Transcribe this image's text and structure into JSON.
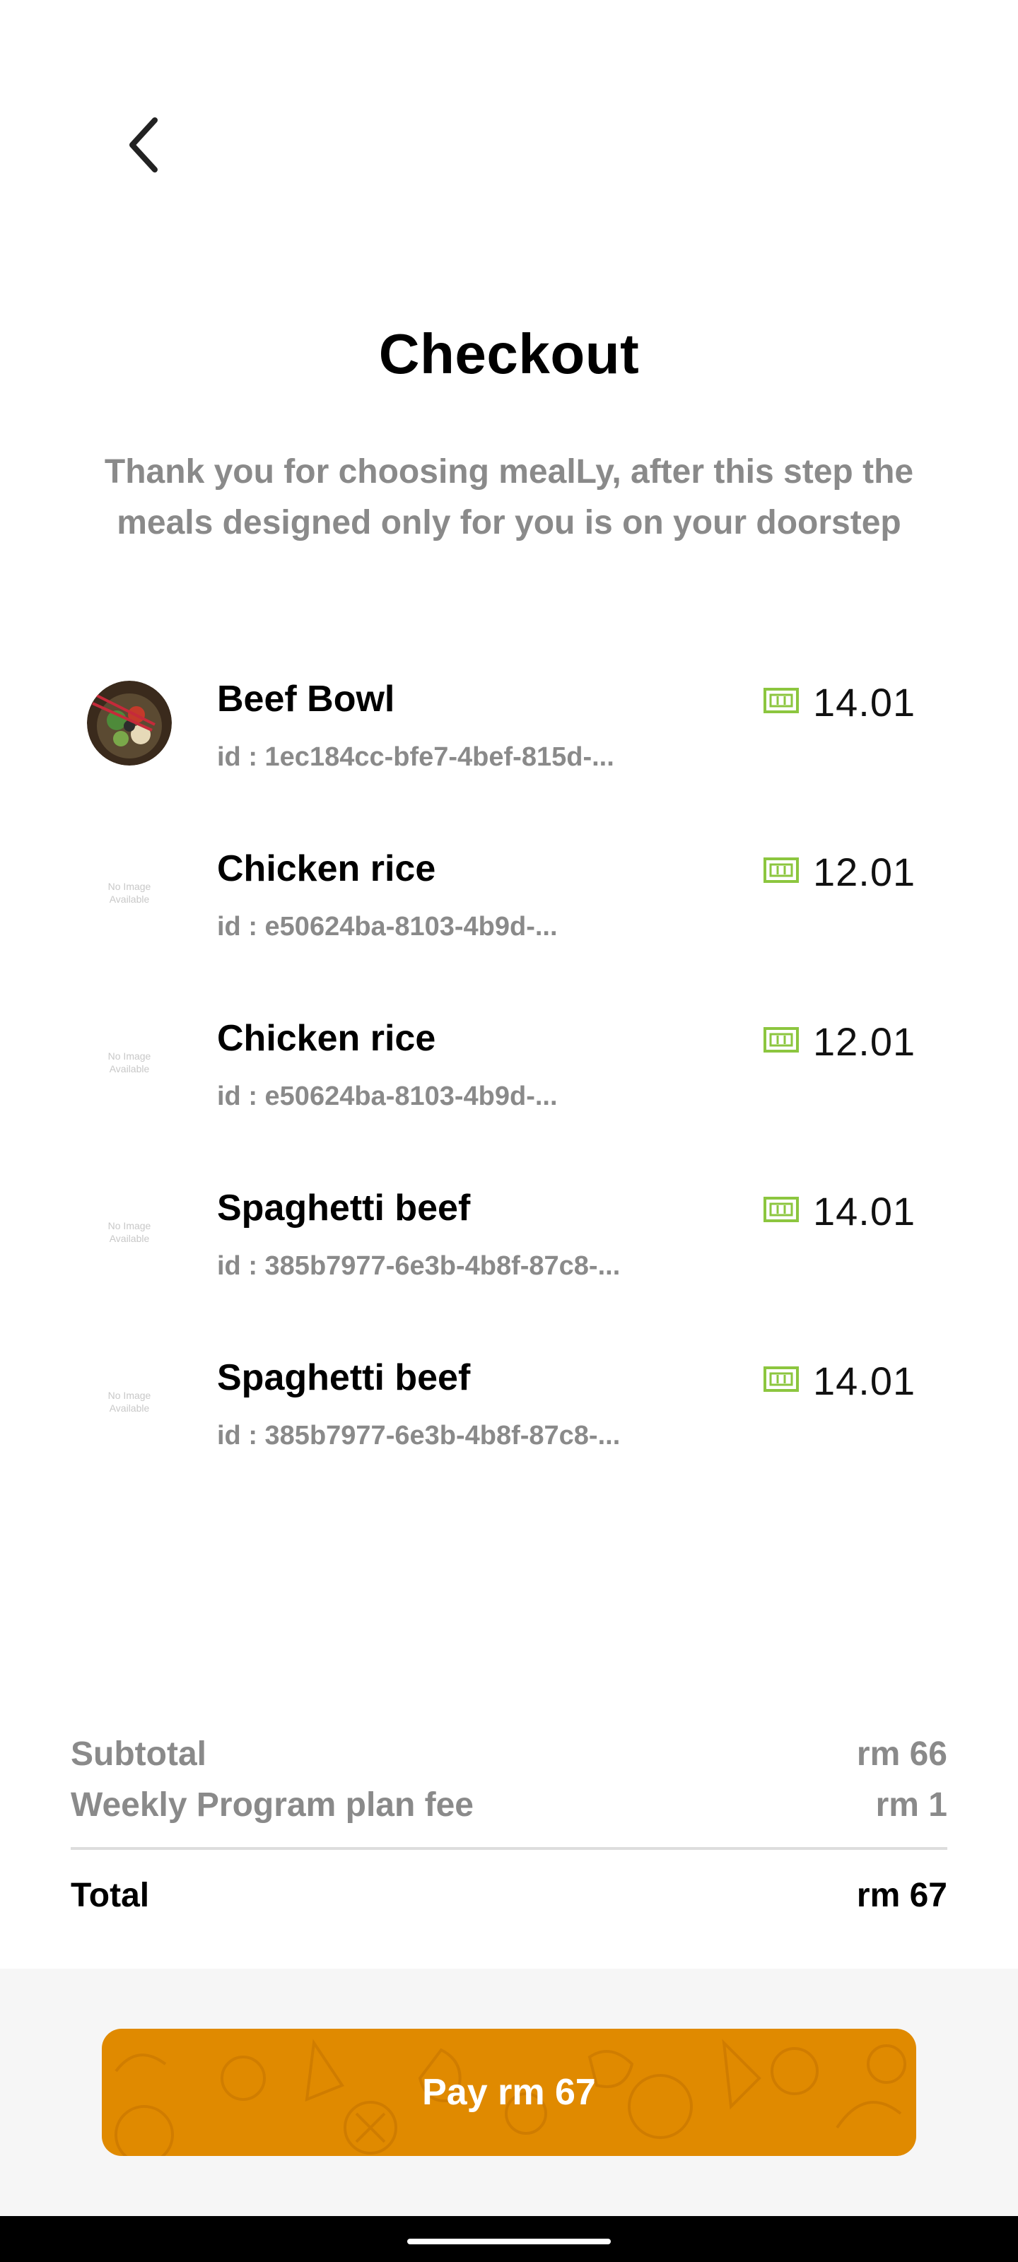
{
  "header": {
    "back_icon": "chevron-left-icon",
    "title": "Checkout",
    "subtitle_line1": "Thank you for choosing mealLy, after this step the",
    "subtitle_line2": "meals designed only for you is on your doorstep"
  },
  "items": [
    {
      "name": "Beef Bowl",
      "id": "id : 1ec184cc-bfe7-4bef-815d-...",
      "price": "14.01",
      "image": "food-photo",
      "no_image_text": ""
    },
    {
      "name": "Chicken rice",
      "id": "id : e50624ba-8103-4b9d-...",
      "price": "12.01",
      "image": "no-image",
      "no_image_text": "No Image Available"
    },
    {
      "name": "Chicken rice",
      "id": "id : e50624ba-8103-4b9d-...",
      "price": "12.01",
      "image": "no-image",
      "no_image_text": "No Image Available"
    },
    {
      "name": "Spaghetti beef",
      "id": "id : 385b7977-6e3b-4b8f-87c8-...",
      "price": "14.01",
      "image": "no-image",
      "no_image_text": "No Image Available"
    },
    {
      "name": "Spaghetti beef",
      "id": "id : 385b7977-6e3b-4b8f-87c8-...",
      "price": "14.01",
      "image": "no-image",
      "no_image_text": "No Image Available"
    }
  ],
  "summary": {
    "subtotal_label": "Subtotal",
    "subtotal_value": "rm 66",
    "fee_label": "Weekly Program plan fee",
    "fee_value": "rm 1",
    "total_label": "Total",
    "total_value": "rm 67"
  },
  "pay_button": {
    "label": "Pay rm 67"
  },
  "colors": {
    "accent_orange": "#e08a00",
    "money_icon_green": "#8cc63f",
    "muted_text": "#8a8a8a"
  },
  "icons": {
    "price": "money-bill-icon"
  }
}
